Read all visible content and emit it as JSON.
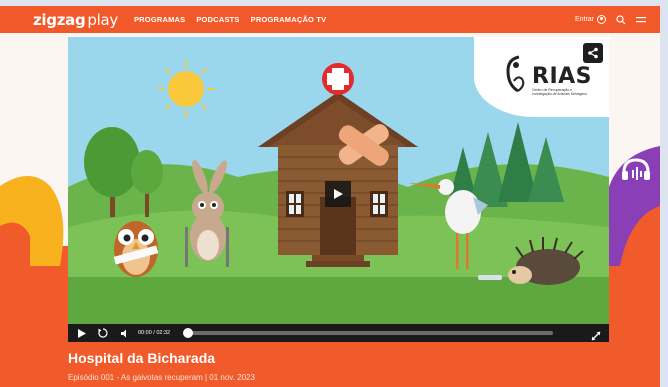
{
  "header": {
    "logo_main": "zigzag",
    "logo_play": "play",
    "nav": [
      "PROGRAMAS",
      "PODCASTS",
      "PROGRAMAÇÃO TV"
    ],
    "login_label": "Entrar",
    "brand_color": "#f2592a"
  },
  "video": {
    "sponsor_logo": "RIAS",
    "sponsor_subtitle": "Centro de Recuperação e Investigação de Animais Selvagens",
    "time": "00:00 / 02:32",
    "progress": 0
  },
  "episode": {
    "title": "Hospital da Bicharada",
    "subtitle": "Episódio 001 - As gaivotas recuperam | 01 nov. 2023"
  },
  "icons": [
    "user-icon",
    "search-icon",
    "menu-icon",
    "share-icon",
    "play-icon",
    "replay-icon",
    "volume-icon",
    "fullscreen-icon",
    "headphones-icon"
  ]
}
